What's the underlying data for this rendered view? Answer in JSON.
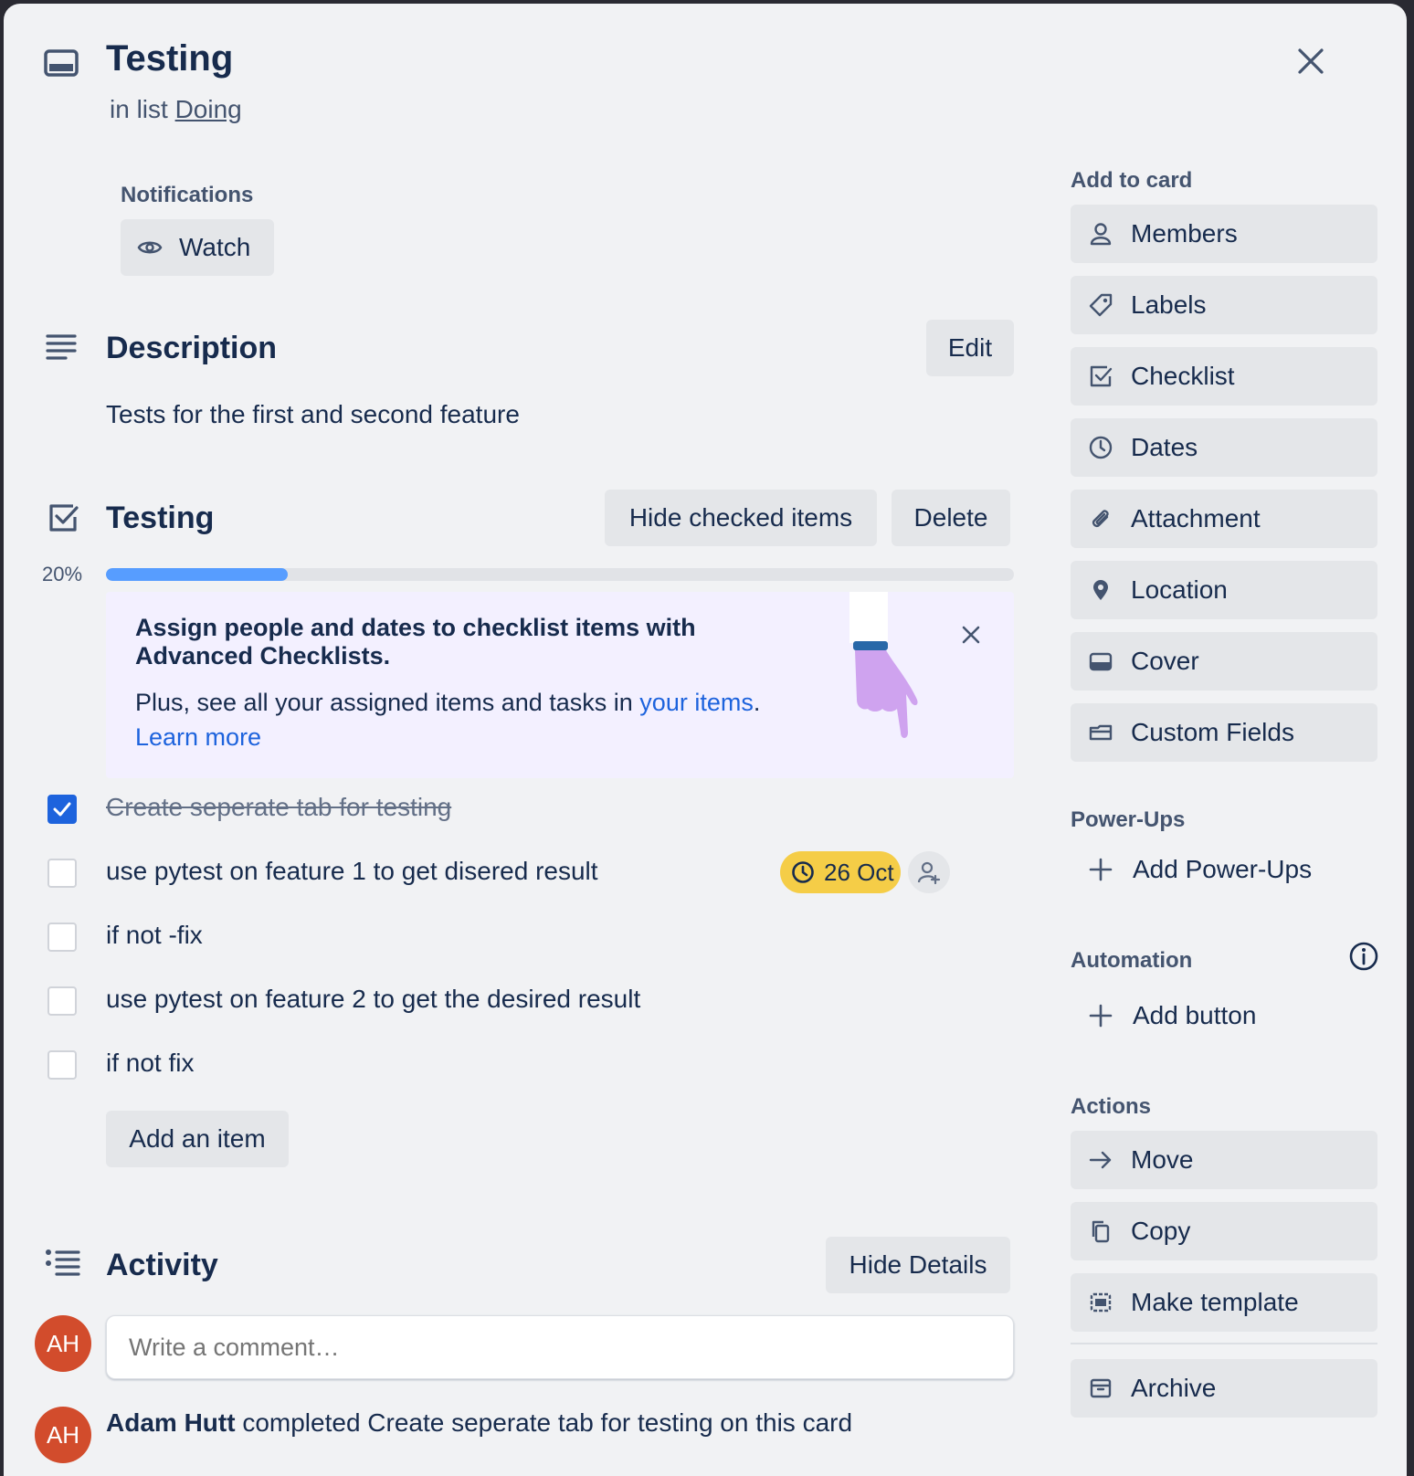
{
  "card": {
    "title": "Testing",
    "list_prefix": "in list",
    "list_name": "Doing"
  },
  "notifications": {
    "heading": "Notifications",
    "watch_label": "Watch"
  },
  "description": {
    "heading": "Description",
    "edit_label": "Edit",
    "text": "Tests for the first and second feature"
  },
  "checklist": {
    "heading": "Testing",
    "hide_checked_label": "Hide checked items",
    "delete_label": "Delete",
    "progress_text": "20%",
    "progress": 0.2,
    "add_item_label": "Add an item",
    "items": [
      {
        "text": "Create seperate tab for testing",
        "checked": true
      },
      {
        "text": "use pytest on feature 1 to get disered result",
        "checked": false,
        "due": "26 Oct"
      },
      {
        "text": "if not -fix",
        "checked": false
      },
      {
        "text": "use pytest on feature 2 to get the desired result",
        "checked": false
      },
      {
        "text": "if not fix",
        "checked": false
      }
    ]
  },
  "promo": {
    "title": "Assign people and dates to checklist items with Advanced Checklists.",
    "body_prefix": "Plus, see all your assigned items and tasks in",
    "link": "your items",
    "body_suffix": ".",
    "learn_more": "Learn more"
  },
  "activity": {
    "heading": "Activity",
    "hide_details_label": "Hide Details",
    "comment_placeholder": "Write a comment…",
    "avatar_initials": "AH",
    "entry_user": "Adam Hutt",
    "entry_text": "completed Create seperate tab for testing on this card"
  },
  "sidebar": {
    "add_to_card_heading": "Add to card",
    "add_to_card": [
      {
        "label": "Members",
        "icon": "person-icon"
      },
      {
        "label": "Labels",
        "icon": "tag-icon"
      },
      {
        "label": "Checklist",
        "icon": "checklist-icon"
      },
      {
        "label": "Dates",
        "icon": "clock-icon"
      },
      {
        "label": "Attachment",
        "icon": "paperclip-icon"
      },
      {
        "label": "Location",
        "icon": "location-pin-icon"
      },
      {
        "label": "Cover",
        "icon": "cover-icon"
      },
      {
        "label": "Custom Fields",
        "icon": "custom-fields-icon"
      }
    ],
    "powerups_heading": "Power-Ups",
    "add_powerups_label": "Add Power-Ups",
    "automation_heading": "Automation",
    "add_button_label": "Add button",
    "actions_heading": "Actions",
    "actions": [
      {
        "label": "Move",
        "icon": "arrow-right-icon"
      },
      {
        "label": "Copy",
        "icon": "copy-icon"
      },
      {
        "label": "Make template",
        "icon": "template-icon"
      },
      {
        "label": "Archive",
        "icon": "archive-icon"
      }
    ]
  },
  "colors": {
    "accent": "#1d63dd",
    "progress": "#579dff",
    "due_badge": "#f5cd47",
    "avatar": "#d24c2c",
    "promo_bg": "#f3f0ff",
    "link": "#1d63dd"
  }
}
